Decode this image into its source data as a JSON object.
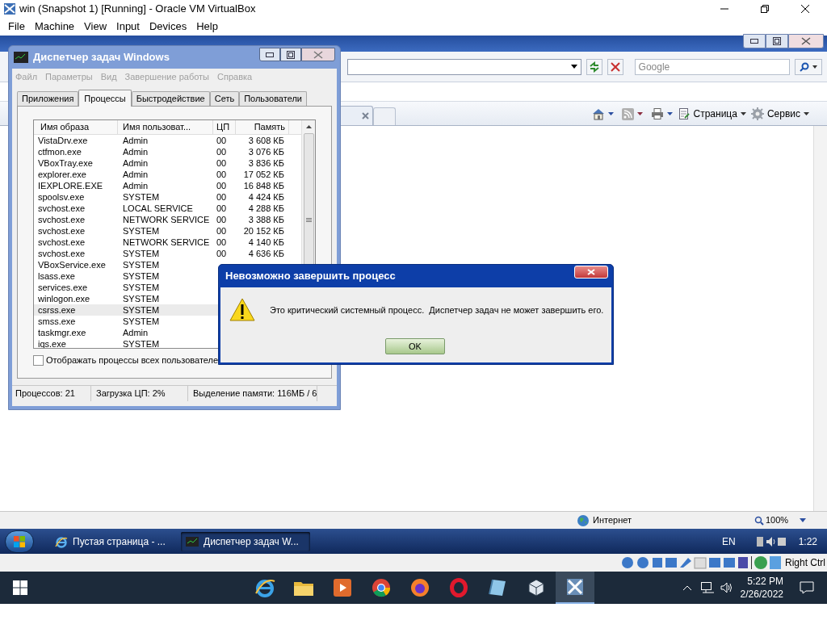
{
  "host_window": {
    "title": "win (Snapshot 1) [Running] - Oracle VM VirtualBox",
    "menu": [
      "File",
      "Machine",
      "View",
      "Input",
      "Devices",
      "Help"
    ]
  },
  "browser": {
    "search_placeholder": "Google",
    "commands": [
      "Страница",
      "Сервис"
    ],
    "status": "Интернет",
    "zoom": "100%"
  },
  "task_manager": {
    "title": "Диспетчер задач Windows",
    "menu": [
      "Файл",
      "Параметры",
      "Вид",
      "Завершение работы",
      "Справка"
    ],
    "tabs": [
      {
        "label": "Приложения",
        "selected": false
      },
      {
        "label": "Процессы",
        "selected": true
      },
      {
        "label": "Быстродействие",
        "selected": false
      },
      {
        "label": "Сеть",
        "selected": false
      },
      {
        "label": "Пользователи",
        "selected": false
      }
    ],
    "columns": [
      "Имя образа",
      "Имя пользоват...",
      "ЦП",
      "Память"
    ],
    "rows": [
      {
        "image": "VistaDrv.exe",
        "user": "Admin",
        "cpu": "00",
        "memory": "3 608 КБ",
        "selected": false
      },
      {
        "image": "ctfmon.exe",
        "user": "Admin",
        "cpu": "00",
        "memory": "3 076 КБ",
        "selected": false
      },
      {
        "image": "VBoxTray.exe",
        "user": "Admin",
        "cpu": "00",
        "memory": "3 836 КБ",
        "selected": false
      },
      {
        "image": "explorer.exe",
        "user": "Admin",
        "cpu": "00",
        "memory": "17 052 КБ",
        "selected": false
      },
      {
        "image": "IEXPLORE.EXE",
        "user": "Admin",
        "cpu": "00",
        "memory": "16 848 КБ",
        "selected": false
      },
      {
        "image": "spoolsv.exe",
        "user": "SYSTEM",
        "cpu": "00",
        "memory": "4 424 КБ",
        "selected": false
      },
      {
        "image": "svchost.exe",
        "user": "LOCAL SERVICE",
        "cpu": "00",
        "memory": "4 288 КБ",
        "selected": false
      },
      {
        "image": "svchost.exe",
        "user": "NETWORK SERVICE",
        "cpu": "00",
        "memory": "3 388 КБ",
        "selected": false
      },
      {
        "image": "svchost.exe",
        "user": "SYSTEM",
        "cpu": "00",
        "memory": "20 152 КБ",
        "selected": false
      },
      {
        "image": "svchost.exe",
        "user": "NETWORK SERVICE",
        "cpu": "00",
        "memory": "4 140 КБ",
        "selected": false
      },
      {
        "image": "svchost.exe",
        "user": "SYSTEM",
        "cpu": "00",
        "memory": "4 636 КБ",
        "selected": false
      },
      {
        "image": "VBoxService.exe",
        "user": "SYSTEM",
        "selected": false
      },
      {
        "image": "lsass.exe",
        "user": "SYSTEM",
        "selected": false
      },
      {
        "image": "services.exe",
        "user": "SYSTEM",
        "selected": false
      },
      {
        "image": "winlogon.exe",
        "user": "SYSTEM",
        "selected": false
      },
      {
        "image": "csrss.exe",
        "user": "SYSTEM",
        "selected": true
      },
      {
        "image": "smss.exe",
        "user": "SYSTEM",
        "selected": false
      },
      {
        "image": "taskmgr.exe",
        "user": "Admin",
        "selected": false
      },
      {
        "image": "iqs.exe",
        "user": "SYSTEM",
        "selected": false
      }
    ],
    "show_all": {
      "label": "Отображать процессы всех пользователе",
      "checked": false
    },
    "status": [
      "Процессов: 21",
      "Загрузка ЦП: 2%",
      "Выделение памяти: 116МБ / 6"
    ]
  },
  "dialog": {
    "title": "Невозможно завершить процесс",
    "message": "Это критический системный процесс.  Диспетчер задач не может завершить его.",
    "button": "OK"
  },
  "guest_taskbar": {
    "items": [
      {
        "label": "Пустая страница - ...",
        "selected": false
      },
      {
        "label": "Диспетчер задач W...",
        "selected": true
      }
    ],
    "language": "EN",
    "time": "1:22"
  },
  "vbox_status": {
    "host_key": "Right Ctrl"
  },
  "host_taskbar": {
    "time": "5:22 PM",
    "date": "2/26/2022"
  }
}
